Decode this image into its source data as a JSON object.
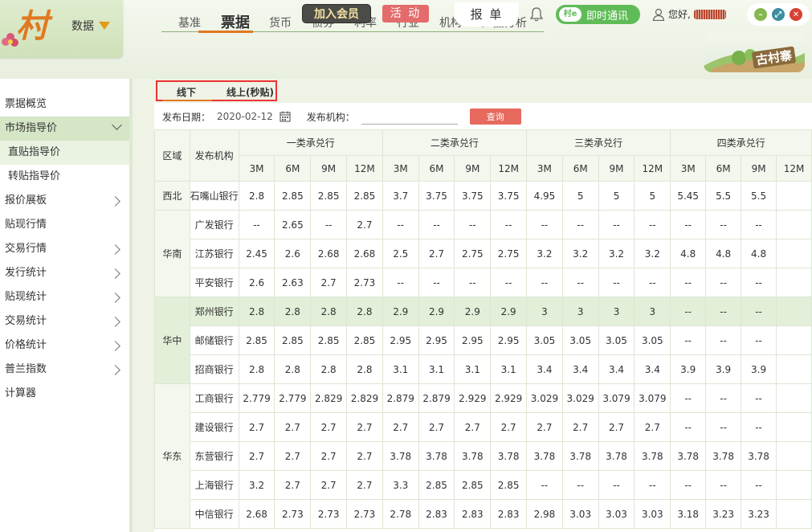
{
  "header": {
    "logo_text": "村",
    "data_menu_label": "数据",
    "nav_items": [
      "基准",
      "票据",
      "货币",
      "债券",
      "利率",
      "行业",
      "机构",
      "产品分析"
    ],
    "join_label": "加入会员",
    "activity_label": "活 动",
    "report_label": "报 单",
    "chat_logo": "村e",
    "chat_label": "即时通讯",
    "greeting": "您好,",
    "village_label": "古村寨"
  },
  "sidebar": {
    "items": [
      {
        "label": "票据概览"
      },
      {
        "label": "市场指导价"
      },
      {
        "label": "直贴指导价"
      },
      {
        "label": "转贴指导价"
      },
      {
        "label": "报价展板"
      },
      {
        "label": "贴现行情"
      },
      {
        "label": "交易行情"
      },
      {
        "label": "发行统计"
      },
      {
        "label": "贴现统计"
      },
      {
        "label": "交易统计"
      },
      {
        "label": "价格统计"
      },
      {
        "label": "普兰指数"
      },
      {
        "label": "计算器"
      }
    ]
  },
  "tabs": {
    "offline": "线下",
    "online": "线上(秒贴)"
  },
  "filters": {
    "date_label": "发布日期：",
    "date_value": "2020-02-12",
    "org_label": "发布机构：",
    "org_value": "",
    "query_label": "查询"
  },
  "table": {
    "col_region": "区域",
    "col_org": "发布机构",
    "groups": [
      "一类承兑行",
      "二类承兑行",
      "三类承兑行",
      "四类承兑行"
    ],
    "terms": [
      "3M",
      "6M",
      "9M",
      "12M"
    ],
    "rows": [
      {
        "region": "西北",
        "org": "石嘴山银行",
        "v": [
          "2.8",
          "2.85",
          "2.85",
          "2.85",
          "3.7",
          "3.75",
          "3.75",
          "3.75",
          "4.95",
          "5",
          "5",
          "5",
          "5.45",
          "5.5",
          "5.5"
        ]
      },
      {
        "region": "华南",
        "org": "广发银行",
        "v": [
          "--",
          "2.65",
          "--",
          "2.7",
          "--",
          "--",
          "--",
          "--",
          "--",
          "--",
          "--",
          "--",
          "--",
          "--",
          "--"
        ]
      },
      {
        "region": "",
        "org": "江苏银行",
        "v": [
          "2.45",
          "2.6",
          "2.68",
          "2.68",
          "2.5",
          "2.7",
          "2.75",
          "2.75",
          "3.2",
          "3.2",
          "3.2",
          "3.2",
          "4.8",
          "4.8",
          "4.8"
        ]
      },
      {
        "region": "",
        "org": "平安银行",
        "v": [
          "2.6",
          "2.63",
          "2.7",
          "2.73",
          "--",
          "--",
          "--",
          "--",
          "--",
          "--",
          "--",
          "--",
          "--",
          "--",
          "--"
        ]
      },
      {
        "region": "华中",
        "org": "郑州银行",
        "v": [
          "2.8",
          "2.8",
          "2.8",
          "2.8",
          "2.9",
          "2.9",
          "2.9",
          "2.9",
          "3",
          "3",
          "3",
          "3",
          "--",
          "--",
          "--"
        ]
      },
      {
        "region": "",
        "org": "邮储银行",
        "v": [
          "2.85",
          "2.85",
          "2.85",
          "2.85",
          "2.95",
          "2.95",
          "2.95",
          "2.95",
          "3.05",
          "3.05",
          "3.05",
          "3.05",
          "--",
          "--",
          "--"
        ]
      },
      {
        "region": "",
        "org": "招商银行",
        "v": [
          "2.8",
          "2.8",
          "2.8",
          "2.8",
          "3.1",
          "3.1",
          "3.1",
          "3.1",
          "3.4",
          "3.4",
          "3.4",
          "3.4",
          "3.9",
          "3.9",
          "3.9"
        ]
      },
      {
        "region": "华东",
        "org": "工商银行",
        "v": [
          "2.779",
          "2.779",
          "2.829",
          "2.829",
          "2.879",
          "2.879",
          "2.929",
          "2.929",
          "3.029",
          "3.029",
          "3.079",
          "3.079",
          "--",
          "--",
          "--"
        ]
      },
      {
        "region": "",
        "org": "建设银行",
        "v": [
          "2.7",
          "2.7",
          "2.7",
          "2.7",
          "2.7",
          "2.7",
          "2.7",
          "2.7",
          "2.7",
          "2.7",
          "2.7",
          "2.7",
          "--",
          "--",
          "--"
        ]
      },
      {
        "region": "",
        "org": "东营银行",
        "v": [
          "2.7",
          "2.7",
          "2.7",
          "2.7",
          "3.78",
          "3.78",
          "3.78",
          "3.78",
          "3.78",
          "3.78",
          "3.78",
          "3.78",
          "3.78",
          "3.78",
          "3.78"
        ]
      },
      {
        "region": "",
        "org": "上海银行",
        "v": [
          "3.2",
          "2.7",
          "2.7",
          "2.7",
          "3.3",
          "2.85",
          "2.85",
          "2.85",
          "--",
          "--",
          "--",
          "--",
          "--",
          "--",
          "--"
        ]
      },
      {
        "region": "",
        "org": "中信银行",
        "v": [
          "2.68",
          "2.73",
          "2.73",
          "2.73",
          "2.78",
          "2.83",
          "2.83",
          "2.83",
          "2.98",
          "3.03",
          "3.03",
          "3.03",
          "3.18",
          "3.23",
          "3.23"
        ]
      }
    ],
    "region_spans": {
      "0": 1,
      "1": 3,
      "4": 3,
      "7": 5
    },
    "highlight_row": 4
  },
  "colors": {
    "accent_orange": "#e0791f",
    "query_red": "#e66a5d",
    "chat_green": "#5fbb57",
    "highlight_green": "#e3efd8"
  }
}
